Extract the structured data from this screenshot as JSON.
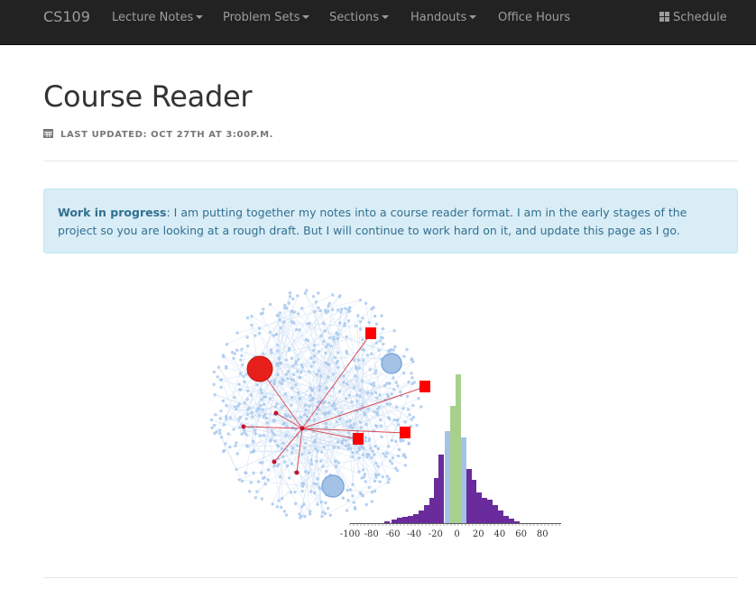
{
  "nav": {
    "brand": "CS109",
    "items": [
      {
        "label": "Lecture Notes",
        "has_caret": true
      },
      {
        "label": "Problem Sets",
        "has_caret": true
      },
      {
        "label": "Sections",
        "has_caret": true
      },
      {
        "label": "Handouts",
        "has_caret": true
      },
      {
        "label": "Office Hours",
        "has_caret": false
      }
    ],
    "schedule_label": "Schedule"
  },
  "page": {
    "title": "Course Reader",
    "last_updated": "LAST UPDATED: OCT 27TH AT 3:00P.M."
  },
  "alert": {
    "strong": "Work in progress",
    "text": ": I am putting together my notes into a course reader format. I am in the early stages of the project so you are looking at a rough draft. But I will continue to work hard on it, and update this page as I go."
  },
  "figure": {
    "axis_ticks": [
      "-100",
      "-80",
      "-60",
      "-40",
      "-20",
      "0",
      "20",
      "40",
      "60",
      "80"
    ],
    "colors": {
      "network": "#a9c9ee",
      "red": "#e8201c",
      "purple": "#6a2c9c",
      "blue_bar": "#a4c2e6",
      "green_bar": "#a8d08d"
    }
  },
  "icons": {
    "schedule": "grid-icon",
    "updated": "calendar-icon"
  }
}
